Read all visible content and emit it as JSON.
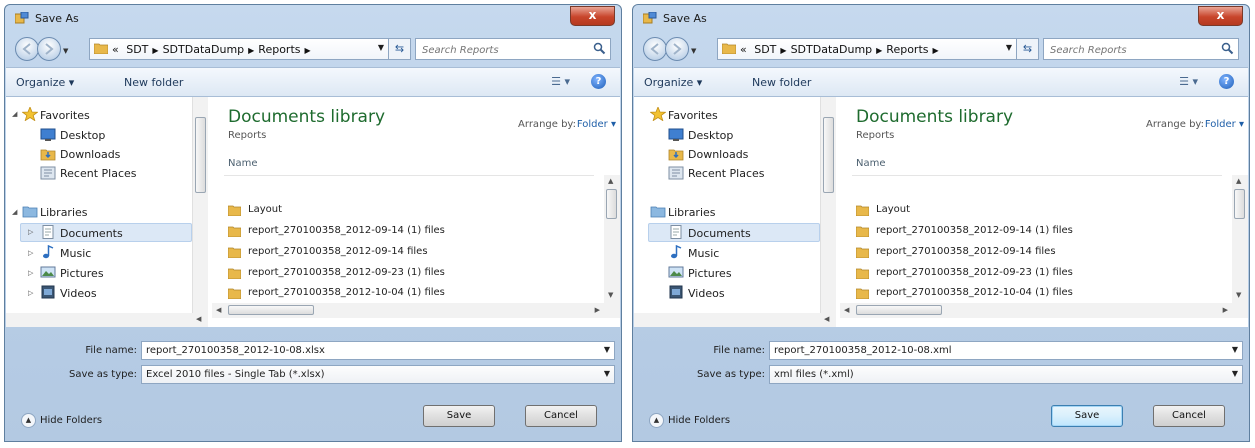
{
  "dialogs": [
    {
      "title": "Save As",
      "close_glyph": "x",
      "breadcrumb": [
        "«",
        "SDT",
        "SDTDataDump",
        "Reports"
      ],
      "search_placeholder": "Search Reports",
      "toolbar": {
        "organize": "Organize ▾",
        "new_folder": "New folder"
      },
      "nav": {
        "favorites": "Favorites",
        "desktop": "Desktop",
        "downloads": "Downloads",
        "recent": "Recent Places",
        "libraries": "Libraries",
        "documents": "Documents",
        "music": "Music",
        "pictures": "Pictures",
        "videos": "Videos"
      },
      "library": {
        "title": "Documents library",
        "subtitle": "Reports",
        "arrange_label": "Arrange by:",
        "arrange_value": "Folder ▾"
      },
      "column_name": "Name",
      "files": [
        "Layout",
        "report_270100358_2012-09-14 (1) files",
        "report_270100358_2012-09-14 files",
        "report_270100358_2012-09-23 (1) files",
        "report_270100358_2012-10-04 (1) files"
      ],
      "file_name_label": "File name:",
      "file_name": "report_270100358_2012-10-08.xlsx",
      "save_type_label": "Save as type:",
      "save_type": "Excel 2010 files - Single Tab (*.xlsx)",
      "hide_folders": "Hide Folders",
      "save": "Save",
      "cancel": "Cancel"
    },
    {
      "title": "Save As",
      "close_glyph": "x",
      "breadcrumb": [
        "«",
        "SDT",
        "SDTDataDump",
        "Reports"
      ],
      "search_placeholder": "Search Reports",
      "toolbar": {
        "organize": "Organize ▾",
        "new_folder": "New folder"
      },
      "nav": {
        "favorites": "Favorites",
        "desktop": "Desktop",
        "downloads": "Downloads",
        "recent": "Recent Places",
        "libraries": "Libraries",
        "documents": "Documents",
        "music": "Music",
        "pictures": "Pictures",
        "videos": "Videos"
      },
      "library": {
        "title": "Documents library",
        "subtitle": "Reports",
        "arrange_label": "Arrange by:",
        "arrange_value": "Folder ▾"
      },
      "column_name": "Name",
      "files": [
        "Layout",
        "report_270100358_2012-09-14 (1) files",
        "report_270100358_2012-09-14 files",
        "report_270100358_2012-09-23 (1) files",
        "report_270100358_2012-10-04 (1) files"
      ],
      "file_name_label": "File name:",
      "file_name": "report_270100358_2012-10-08.xml",
      "save_type_label": "Save as type:",
      "save_type": "xml files (*.xml)",
      "hide_folders": "Hide Folders",
      "save": "Save",
      "cancel": "Cancel"
    }
  ],
  "colors": {
    "library_title": "#1e6b2e",
    "title_bar": "#c6d9ee",
    "close_button": "#c8452b",
    "folder": "#e8b84a"
  },
  "icons": [
    "app-icon",
    "back-arrow-icon",
    "forward-arrow-icon",
    "folder-icon",
    "refresh-icon",
    "search-icon",
    "help-icon",
    "star-icon",
    "desktop-icon",
    "downloads-icon",
    "recent-places-icon",
    "libraries-icon",
    "documents-icon",
    "music-icon",
    "pictures-icon",
    "videos-icon"
  ]
}
